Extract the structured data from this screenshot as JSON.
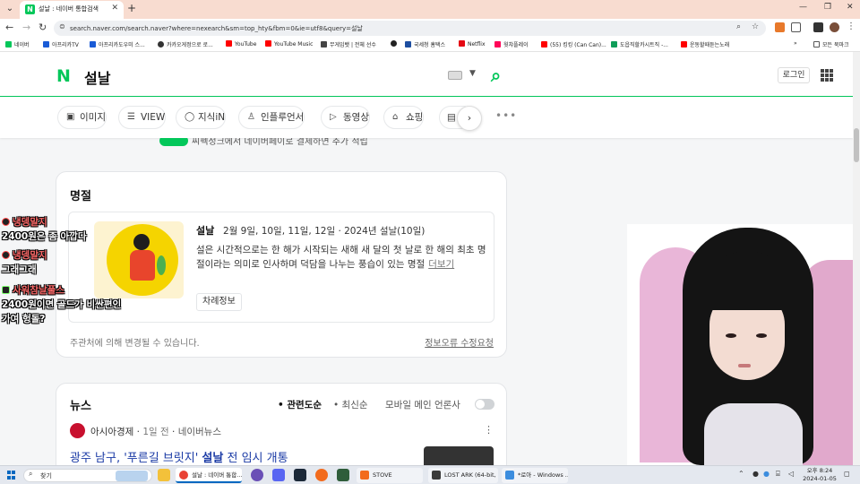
{
  "browser": {
    "tab_title": "설날 : 네이버 통합검색",
    "url": "search.naver.com/search.naver?where=nexearch&sm=top_hty&fbm=0&ie=utf8&query=설날",
    "bookmarks": [
      "네이버",
      "아프리카TV",
      "아프리카도우미 스...",
      "카카오게정으로 로...",
      "YouTube",
      "YouTube Music",
      "무게임뱃 | 전체 선수",
      "",
      "국세청 홈택스",
      "Netflix",
      "윗챠플레이",
      "(55) 킹킹 (Can Can)...",
      "도읍직할카시트직 -...",
      "운동할때듣는노래"
    ],
    "all_bookmarks": "모든 북마크",
    "colors": {
      "tab_bar": "#f8dcd0",
      "accent": "#0067c0"
    }
  },
  "naver": {
    "logo": "N",
    "query": "설날",
    "login_label": "로그인",
    "tabs": [
      {
        "label": "이미지",
        "icon": "image-icon"
      },
      {
        "label": "VIEW",
        "icon": "list-icon"
      },
      {
        "label": "지식iN",
        "icon": "question-icon"
      },
      {
        "label": "인플루언서",
        "icon": "person-icon"
      },
      {
        "label": "동영상",
        "icon": "play-icon"
      },
      {
        "label": "쇼핑",
        "icon": "bag-icon"
      }
    ],
    "colors": {
      "brand": "#03c75a",
      "link": "#1a3aa5"
    }
  },
  "partial_text": "씨펙정크에서 네이버페이로 결제하면 추가 적립",
  "myeongjeol": {
    "title": "명절",
    "name": "설날",
    "dates": "2월 9일, 10일, 11일, 12일 · 2024년 설날(10일)",
    "description": "설은 시간적으로는 한 해가 시작되는 새해 새 달의 첫 날로 한 해의 최초 명절이라는 의미로 인사하며 덕담을 나누는 풍습이 있는 명절",
    "more_label": "더보기",
    "chip_label": "차례정보",
    "note": "주관처에 의해 변경될 수 있습니다.",
    "report_label": "정보오류 수정요청"
  },
  "news": {
    "title": "뉴스",
    "sort_related": "관련도순",
    "sort_latest": "최신순",
    "mobile_main": "모바일 메인 언론사",
    "press": "아시아경제",
    "time": "1일 전",
    "source": "네이버뉴스",
    "headline_pre": "광주 남구, '푸른길 브릿지' ",
    "headline_bold": "설날",
    "headline_post": " 전 임시 개통"
  },
  "chat": [
    {
      "user": "냉뎅말지",
      "msg": ""
    },
    {
      "user": "",
      "msg": "2400원은 좀 아깝다"
    },
    {
      "user": "냉뎅말지",
      "msg": ""
    },
    {
      "user": "",
      "msg": "그래그래"
    },
    {
      "user": "사워참날풀스",
      "msg": ""
    },
    {
      "user": "",
      "msg": "2400원이면 골드가 비싼편인"
    },
    {
      "user": "",
      "msg": "가여 헝돌?"
    }
  ],
  "taskbar": {
    "search_label": "찾기",
    "tasks": [
      "설날 : 네이버 통합...",
      "STOVE",
      "LOST ARK (64-bit, ...",
      "*로아 - Windows ..."
    ],
    "time": "오후 8:24",
    "date": "2024-01-05"
  }
}
